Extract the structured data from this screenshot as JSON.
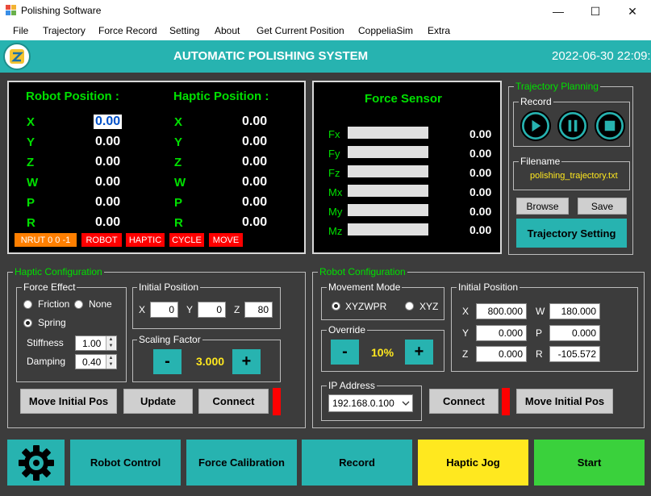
{
  "window": {
    "title": "Polishing Software"
  },
  "menu": [
    "File",
    "Trajectory",
    "Force Record",
    "Setting",
    "About",
    "Get Current Position",
    "CoppeliaSim",
    "Extra"
  ],
  "header": {
    "title": "AUTOMATIC POLISHING SYSTEM",
    "datetime": "2022-06-30  22:09:"
  },
  "robot_position": {
    "title": "Robot Position :",
    "axes": [
      "X",
      "Y",
      "Z",
      "W",
      "P",
      "R"
    ],
    "values": [
      "0.00",
      "0.00",
      "0.00",
      "0.00",
      "0.00",
      "0.00"
    ]
  },
  "haptic_position": {
    "title": "Haptic Position :",
    "axes": [
      "X",
      "Y",
      "Z",
      "W",
      "P",
      "R"
    ],
    "values": [
      "0.00",
      "0.00",
      "0.00",
      "0.00",
      "0.00",
      "0.00"
    ]
  },
  "status": {
    "nrut": "NRUT 0 0 -1",
    "robot": "ROBOT",
    "haptic": "HAPTIC",
    "cycle": "CYCLE",
    "move": "MOVE",
    "colors": {
      "nrut": "#ff7f00",
      "others": "#ff0000"
    }
  },
  "force_sensor": {
    "title": "Force Sensor",
    "labels": [
      "Fx",
      "Fy",
      "Fz",
      "Mx",
      "My",
      "Mz"
    ],
    "values": [
      "0.00",
      "0.00",
      "0.00",
      "0.00",
      "0.00",
      "0.00"
    ]
  },
  "trajectory_planning": {
    "title": "Trajectory Planning",
    "record_label": "Record",
    "filename_label": "Filename",
    "filename": "polishing_trajectory.txt",
    "browse": "Browse",
    "save": "Save",
    "setting": "Trajectory Setting"
  },
  "haptic_config": {
    "title": "Haptic Configuration",
    "force_effect": {
      "title": "Force Effect",
      "friction": "Friction",
      "none": "None",
      "spring": "Spring",
      "selected": "Spring",
      "stiffness_label": "Stiffness",
      "stiffness": "1.00",
      "damping_label": "Damping",
      "damping": "0.40"
    },
    "initial_position": {
      "title": "Initial Position",
      "x_label": "X",
      "x": "0",
      "y_label": "Y",
      "y": "0",
      "z_label": "Z",
      "z": "80"
    },
    "scaling": {
      "title": "Scaling Factor",
      "minus": "-",
      "value": "3.000",
      "plus": "+"
    },
    "buttons": {
      "move_initial": "Move Initial Pos",
      "update": "Update",
      "connect": "Connect"
    }
  },
  "robot_config": {
    "title": "Robot Configuration",
    "movement_mode": {
      "title": "Movement Mode",
      "xyzwpr": "XYZWPR",
      "xyz": "XYZ",
      "selected": "XYZWPR"
    },
    "override": {
      "title": "Override",
      "minus": "-",
      "value": "10%",
      "plus": "+"
    },
    "initial_position": {
      "title": "Initial Position",
      "x_label": "X",
      "x": "800.000",
      "w_label": "W",
      "w": "180.000",
      "y_label": "Y",
      "y": "0.000",
      "p_label": "P",
      "p": "0.000",
      "z_label": "Z",
      "z": "0.000",
      "r_label": "R",
      "r": "-105.572"
    },
    "ip": {
      "title": "IP Address",
      "value": "192.168.0.100"
    },
    "buttons": {
      "connect": "Connect",
      "move_initial": "Move Initial Pos"
    }
  },
  "bottom": {
    "robot_control": "Robot Control",
    "force_calibration": "Force Calibration",
    "record": "Record",
    "haptic_jog": "Haptic Jog",
    "start": "Start"
  },
  "colors": {
    "teal": "#27b3b0",
    "panel_bg": "#3c3c3c",
    "yellow": "#ffe81f",
    "green_start": "#3ad13c",
    "indicator_red": "#ff0000",
    "label_green": "#00e000"
  }
}
